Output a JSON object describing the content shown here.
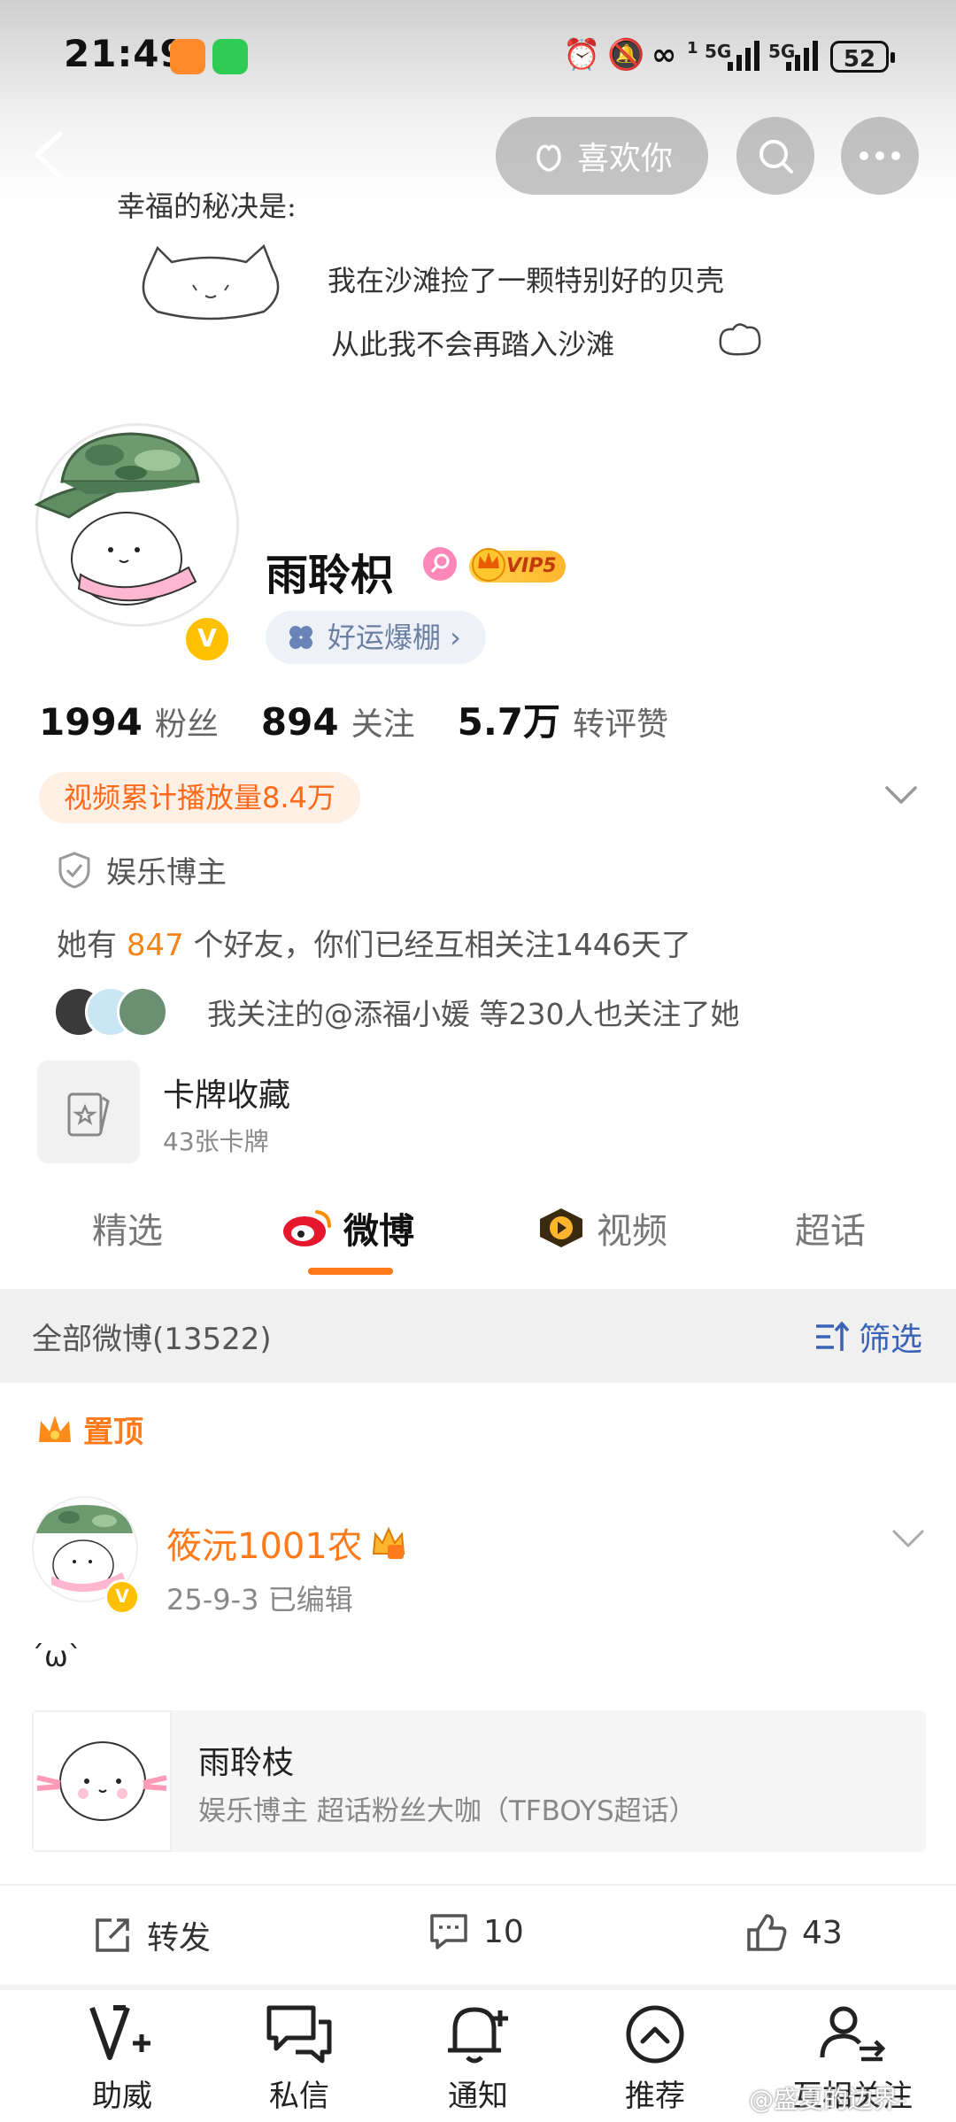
{
  "status_bar": {
    "time": "21:49",
    "battery": "52",
    "network_1": "5G",
    "network_2": "5G",
    "sim_index": "1"
  },
  "header": {
    "like_button": "喜欢你",
    "doodle": {
      "line1": "幸福的秘决是:",
      "line2": "我在沙滩捡了一颗特别好的贝壳",
      "line3": "从此我不会再踏入沙滩"
    }
  },
  "profile": {
    "username": "雨聆枳",
    "vip_label": "VIP5",
    "luck_tag": "好运爆棚 ›",
    "verified_mark": "V",
    "stats": [
      {
        "value": "1994",
        "label": "粉丝"
      },
      {
        "value": "894",
        "label": "关注"
      },
      {
        "value": "5.7万",
        "label": "转评赞"
      }
    ],
    "play_count": "视频累计播放量8.4万",
    "category": "娱乐博主",
    "friends_prefix": "她有",
    "friends_count": "847",
    "friends_suffix": "个好友，你们已经互相关注1446天了",
    "mutual_text": "我关注的@添福小媛 等230人也关注了她",
    "card": {
      "title": "卡牌收藏",
      "subtitle": "43张卡牌"
    }
  },
  "tabs": [
    {
      "label": "精选"
    },
    {
      "label": "微博"
    },
    {
      "label": "视频"
    },
    {
      "label": "超话"
    }
  ],
  "filter": {
    "left": "全部微博(13522)",
    "right": "筛选"
  },
  "pinned_label": "置顶",
  "post": {
    "author": "筱沅1001农",
    "meta": "25-9-3   已编辑",
    "text": "´ω`",
    "share": {
      "title": "雨聆枝",
      "subtitle": "娱乐博主 超话粉丝大咖（TFBOYS超话）"
    },
    "actions": {
      "repost": "转发",
      "comments": "10",
      "likes": "43"
    }
  },
  "bottom_nav": [
    {
      "label": "助威"
    },
    {
      "label": "私信"
    },
    {
      "label": "通知"
    },
    {
      "label": "推荐"
    },
    {
      "label": "互相关注"
    }
  ],
  "watermark": "@盛夏的边界-",
  "colors": {
    "accent": "#ff7a1a",
    "link_blue": "#3a63b8",
    "verified": "#ffc000"
  }
}
